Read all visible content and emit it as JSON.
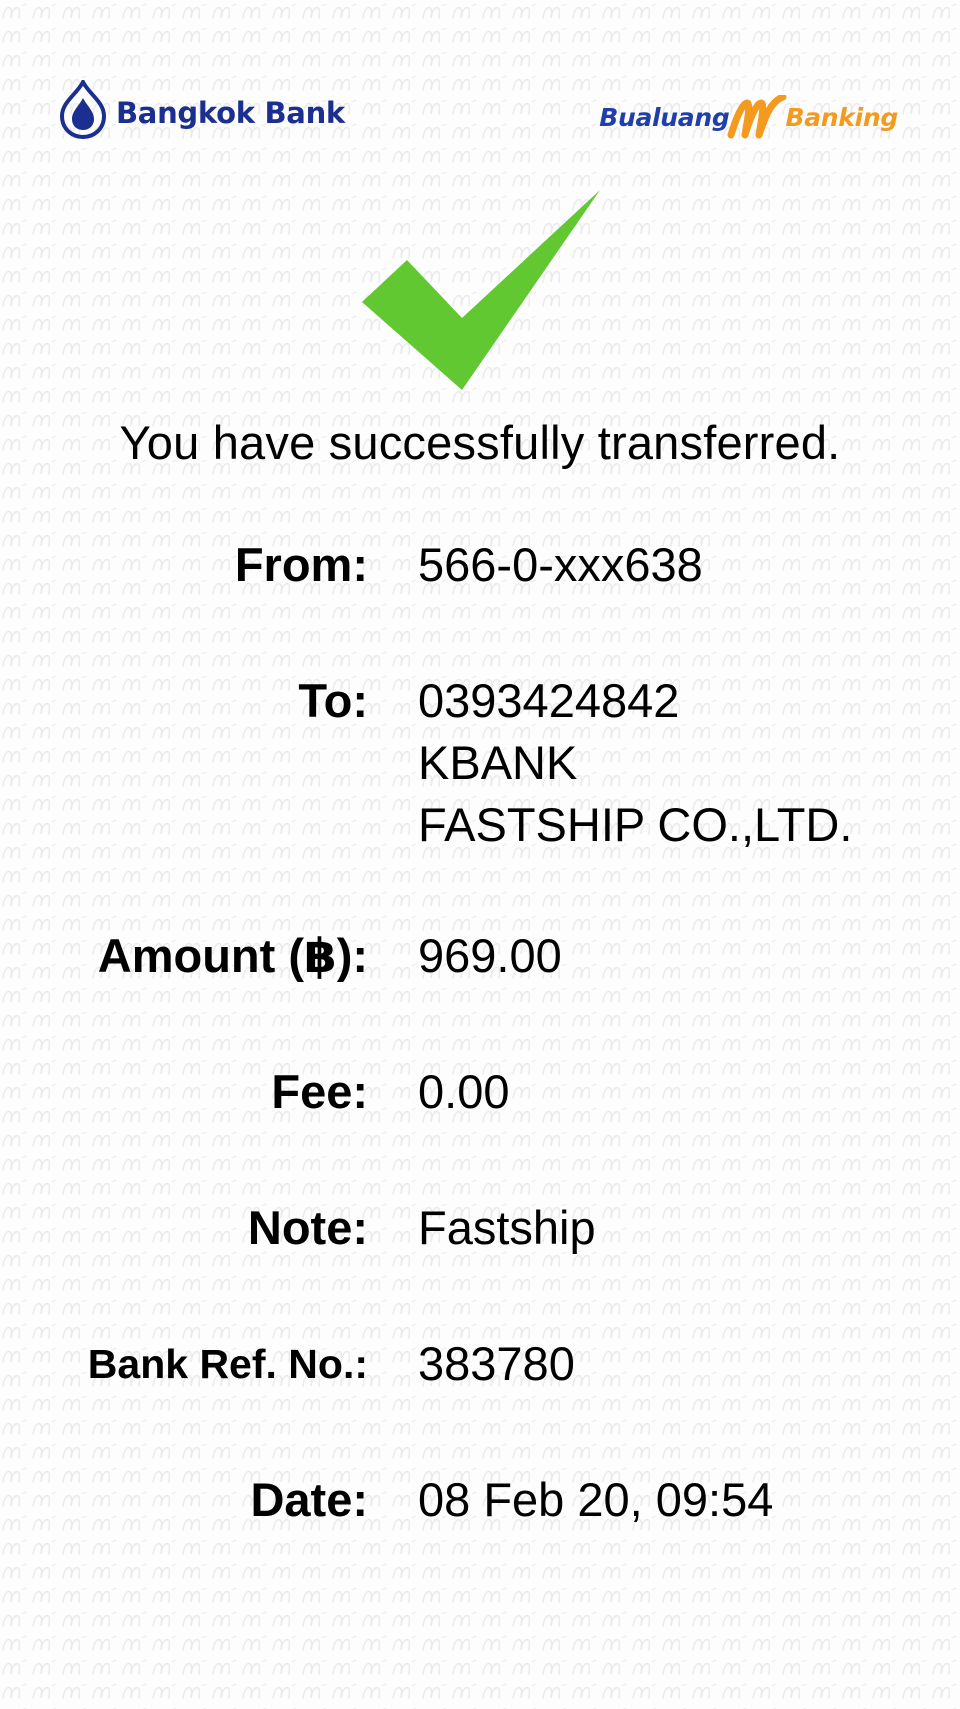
{
  "header": {
    "bank_name": "Bangkok Bank",
    "app_brand_prefix": "Bualuang",
    "app_brand_suffix": "Banking"
  },
  "status": {
    "icon": "check-icon",
    "message": "You have successfully transferred."
  },
  "details": {
    "from_label": "From:",
    "from_value": "566-0-xxx638",
    "to_label": "To:",
    "to_account": "0393424842",
    "to_bank": "KBANK",
    "to_name": "FASTSHIP CO.,LTD.",
    "amount_label": "Amount (฿):",
    "amount_value": "969.00",
    "fee_label": "Fee:",
    "fee_value": "0.00",
    "note_label": "Note:",
    "note_value": "Fastship",
    "ref_label": "Bank Ref. No.:",
    "ref_value": "383780",
    "date_label": "Date:",
    "date_value": "08 Feb 20, 09:54"
  },
  "colors": {
    "brand_blue": "#1a2f8f",
    "brand_orange": "#f39a1f",
    "success_green": "#62c832",
    "background": "#fdfdfd"
  }
}
